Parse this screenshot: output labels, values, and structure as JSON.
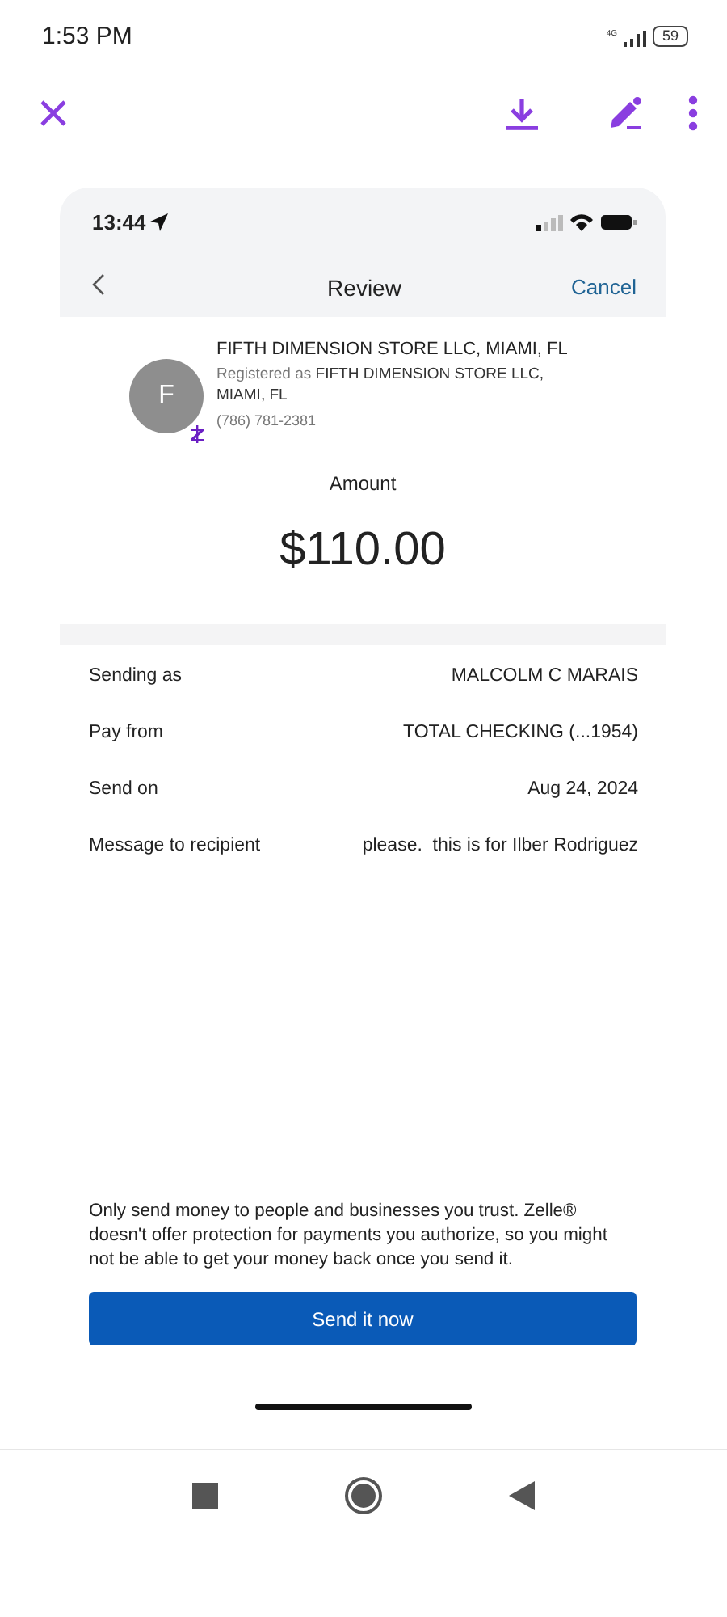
{
  "status_bar": {
    "time": "1:53 PM",
    "network": "4G",
    "battery": "59"
  },
  "screenshot": {
    "status_bar": {
      "time": "13:44"
    },
    "nav": {
      "title": "Review",
      "cancel": "Cancel"
    },
    "recipient": {
      "initial": "F",
      "name": "FIFTH DIMENSION STORE LLC, MIAMI, FL",
      "registered": "Registered as **FIFTH DIMENSION STORE LLC, MIAMI, FL**",
      "phone": "(786) 781-2381"
    },
    "amount": {
      "label": "Amount",
      "value": "$110.00"
    },
    "details": [
      {
        "label": "Sending as",
        "value": "MALCOLM C MARAIS"
      },
      {
        "label": "Pay from",
        "value": "TOTAL CHECKING (...1954)"
      },
      {
        "label": "Send on",
        "value": "Aug 24, 2024"
      },
      {
        "label": "Message to recipient",
        "value": "please.  this is for Ilber Rodriguez"
      }
    ],
    "disclaimer": "Only send money to people and businesses you trust. Zelle® doesn't offer protection for payments you authorize, so you might not be able to get your money back once you send it.",
    "send_button": "Send it now"
  }
}
